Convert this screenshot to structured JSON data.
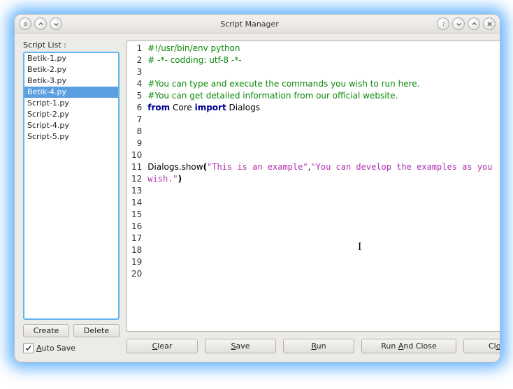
{
  "window": {
    "title": "Script Manager"
  },
  "sidebar": {
    "label": "Script List :",
    "items": [
      {
        "name": "Betik-1.py"
      },
      {
        "name": "Betik-2.py"
      },
      {
        "name": "Betik-3.py"
      },
      {
        "name": "Betik-4.py"
      },
      {
        "name": "Script-1.py"
      },
      {
        "name": "Script-2.py"
      },
      {
        "name": "Script-4.py"
      },
      {
        "name": "Script-5.py"
      }
    ],
    "selected_index": 3,
    "buttons": {
      "create": "Create",
      "delete": "Delete"
    },
    "autosave": {
      "checked": true,
      "label": "Auto Save",
      "accelerator": "A"
    }
  },
  "editor": {
    "line_count": 20,
    "code": {
      "l1": "#!/usr/bin/env python",
      "l2": "# -*- codding: utf-8 -*-",
      "l4": "#You can type and execute the commands you wish to run here.",
      "l5": "#You can get detailed information from our official website.",
      "l6_from": "from",
      "l6_mod": " Core ",
      "l6_import": "import",
      "l6_name": " Dialogs",
      "l11_call": "Dialogs.show",
      "l11_p1": "(",
      "l11_s1": "\"This is an example\"",
      "l11_comma": ",",
      "l11_s2": "\"You can develop the examples as you wish.\"",
      "l11_p2": ")"
    }
  },
  "footer": {
    "clear": "Clear",
    "save": "Save",
    "run": "Run",
    "run_and_close": "Run And Close",
    "close": "Close"
  }
}
